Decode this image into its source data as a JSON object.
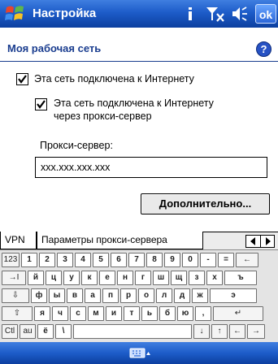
{
  "titlebar": {
    "title": "Настройка",
    "ok_label": "ok"
  },
  "header": {
    "title": "Моя рабочая сеть"
  },
  "settings": {
    "internet_checkbox": {
      "label": "Эта сеть подключена к Интернету",
      "checked": true
    },
    "proxy_checkbox": {
      "label_line1": "Эта сеть подключена к Интернету",
      "label_line2": "через прокси-сервер",
      "checked": true
    },
    "proxy_server_label": "Прокси-сервер:",
    "proxy_server_value": "xxx.xxx.xxx.xxx",
    "advanced_button": "Дополнительно..."
  },
  "tabs": {
    "vpn": "VPN",
    "proxy": "Параметры прокси-сервера",
    "active": "proxy"
  },
  "keyboard": {
    "row1": [
      "123",
      "1",
      "2",
      "3",
      "4",
      "5",
      "6",
      "7",
      "8",
      "9",
      "0",
      "-",
      "=",
      "←"
    ],
    "row2": [
      "→I",
      "й",
      "ц",
      "у",
      "к",
      "е",
      "н",
      "г",
      "ш",
      "щ",
      "з",
      "х",
      "ъ"
    ],
    "row3": [
      "⇩",
      "ф",
      "ы",
      "в",
      "а",
      "п",
      "р",
      "о",
      "л",
      "д",
      "ж",
      "э"
    ],
    "row4": [
      "⇧",
      "я",
      "ч",
      "с",
      "м",
      "и",
      "т",
      "ь",
      "б",
      "ю",
      ",",
      "↵"
    ],
    "row5": [
      "Ctl",
      "au",
      "ё",
      "\\",
      "",
      "↓",
      "↑",
      "←",
      "→"
    ]
  },
  "colors": {
    "bar_blue": "#1d5cc9",
    "title_text": "#1a3d8f"
  }
}
